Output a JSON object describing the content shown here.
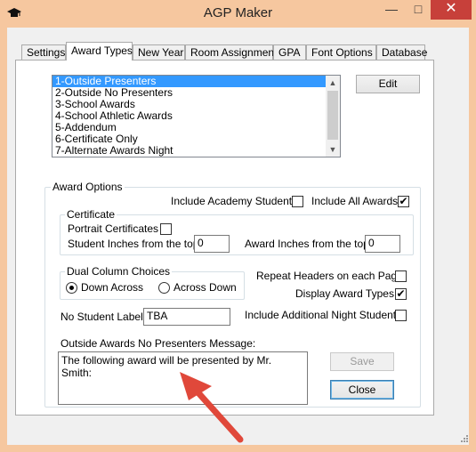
{
  "window": {
    "title": "AGP Maker",
    "minimize": "—",
    "maximize": "□",
    "close": "✕"
  },
  "tabs": [
    {
      "label": "Settings"
    },
    {
      "label": "Award Types"
    },
    {
      "label": "New Year"
    },
    {
      "label": "Room Assignments"
    },
    {
      "label": "GPA"
    },
    {
      "label": "Font Options"
    },
    {
      "label": "Database"
    }
  ],
  "award_list": {
    "items": [
      "1-Outside Presenters",
      "2-Outside No Presenters",
      "3-School Awards",
      "4-School Athletic Awards",
      "5-Addendum",
      "6-Certificate Only",
      "7-Alternate Awards Night"
    ],
    "selected": "1-Outside Presenters"
  },
  "buttons": {
    "edit": "Edit",
    "save": "Save",
    "close": "Close"
  },
  "award_options": {
    "group_label": "Award Options",
    "include_academy_label": "Include Academy Students",
    "include_academy_checked": "",
    "include_all_awards_label": "Include All Awards",
    "include_all_awards_checked": "✔",
    "certificate": {
      "group_label": "Certificate",
      "portrait_label": "Portrait Certificates",
      "portrait_checked": "",
      "student_inches_label": "Student Inches from the top:",
      "student_inches_value": "0",
      "award_inches_label": "Award Inches from the top:",
      "award_inches_value": "0"
    },
    "dual_column": {
      "group_label": "Dual Column Choices",
      "down_across_label": "Down Across",
      "across_down_label": "Across Down",
      "selected": "Down Across"
    },
    "repeat_headers_label": "Repeat Headers on each Page",
    "repeat_headers_checked": "",
    "display_award_types_label": "Display Award Types",
    "display_award_types_checked": "✔",
    "include_night_students_label": "Include Additional Night Students",
    "include_night_students_checked": "",
    "no_student_label": "No Student Label:",
    "no_student_value": "TBA",
    "message_label": "Outside Awards No Presenters Message:",
    "message_value": "The following award will be presented by Mr. Smith:"
  },
  "colors": {
    "selection": "#3399ff",
    "titlebar": "#f6c79f",
    "close_button": "#c7403a",
    "annotation_arrow": "#e0483a"
  }
}
